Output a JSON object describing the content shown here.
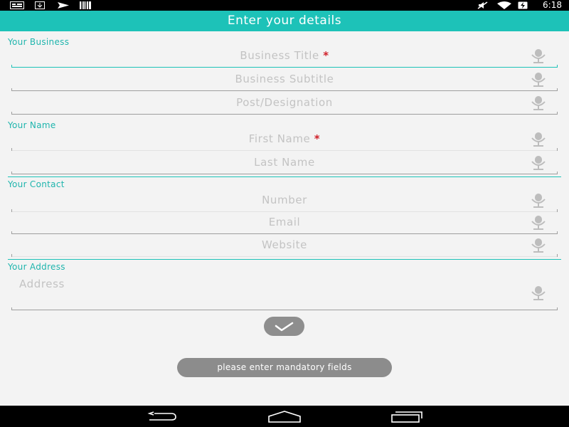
{
  "status_bar": {
    "time": "6:18",
    "left_icons": [
      "notification-card-icon",
      "download-icon",
      "send-icon",
      "barcode-icon"
    ],
    "right_icons": [
      "mute-icon",
      "wifi-icon",
      "battery-charging-icon"
    ]
  },
  "app_bar": {
    "title": "Enter your details"
  },
  "sections": {
    "business": {
      "title": "Your Business"
    },
    "name": {
      "title": "Your Name"
    },
    "contact": {
      "title": "Your Contact"
    },
    "address": {
      "title": "Your Address"
    }
  },
  "fields": {
    "business_title": {
      "placeholder": "Business Title",
      "required_mark": "*",
      "value": ""
    },
    "business_subtitle": {
      "placeholder": "Business Subtitle",
      "value": ""
    },
    "post_designation": {
      "placeholder": "Post/Designation",
      "value": ""
    },
    "first_name": {
      "placeholder": "First Name",
      "required_mark": "*",
      "value": ""
    },
    "last_name": {
      "placeholder": "Last Name",
      "value": ""
    },
    "number": {
      "placeholder": "Number",
      "value": ""
    },
    "email": {
      "placeholder": "Email",
      "value": ""
    },
    "website": {
      "placeholder": "Website",
      "value": ""
    },
    "address": {
      "placeholder": "Address",
      "value": ""
    }
  },
  "toast": {
    "message": "please enter mandatory fields"
  },
  "colors": {
    "accent": "#1dc2b8",
    "required": "#d0212a",
    "background": "#f3f3f3"
  }
}
